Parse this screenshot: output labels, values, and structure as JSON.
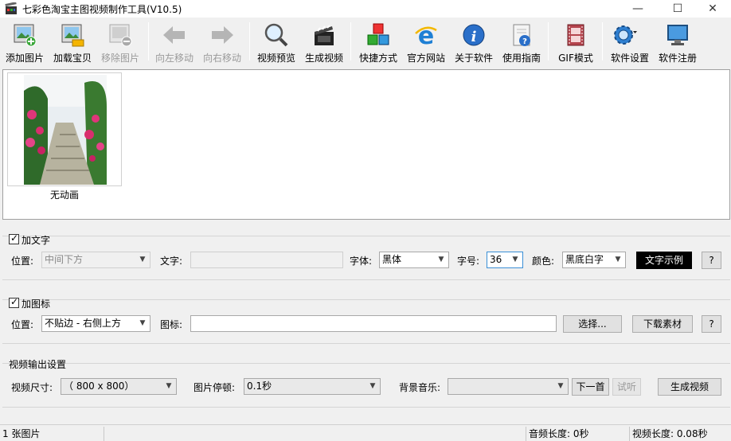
{
  "window": {
    "title": "七彩色淘宝主图视频制作工具(V10.5)",
    "minimize": "—",
    "maximize": "☐",
    "close": "✕"
  },
  "toolbar": {
    "add_image": "添加图片",
    "load_item": "加载宝贝",
    "remove_image": "移除图片",
    "move_left": "向左移动",
    "move_right": "向右移动",
    "preview_video": "视频预览",
    "generate_video": "生成视频",
    "shortcut": "快捷方式",
    "official_site": "官方网站",
    "about": "关于软件",
    "guide": "使用指南",
    "gif_mode": "GIF模式",
    "settings": "软件设置",
    "register": "软件注册"
  },
  "images": [
    {
      "caption": "无动画"
    }
  ],
  "text_group": {
    "checkbox_label": "加文字",
    "position_label": "位置:",
    "position_value": "中间下方",
    "text_label": "文字:",
    "text_value": "",
    "font_label": "字体:",
    "font_value": "黑体",
    "size_label": "字号:",
    "size_value": "36",
    "color_label": "颜色:",
    "color_value": "黑底白字",
    "sample_button": "文字示例",
    "help": "?"
  },
  "icon_group": {
    "checkbox_label": "加图标",
    "position_label": "位置:",
    "position_value": "不贴边 - 右侧上方",
    "icon_label": "图标:",
    "icon_value": "",
    "choose_button": "选择...",
    "download_button": "下载素材",
    "help": "?"
  },
  "output": {
    "section_title": "视频输出设置",
    "size_label": "视频尺寸:",
    "size_value": "（ 800 x  800）",
    "pause_label": "图片停顿:",
    "pause_value": "0.1秒",
    "music_label": "背景音乐:",
    "music_value": "",
    "next_button": "下一首",
    "listen_button": "试听",
    "generate_button": "生成视频"
  },
  "status": {
    "count": "1 张图片",
    "audio_length": "音频长度: 0秒",
    "video_length": "视频长度: 0.08秒"
  }
}
